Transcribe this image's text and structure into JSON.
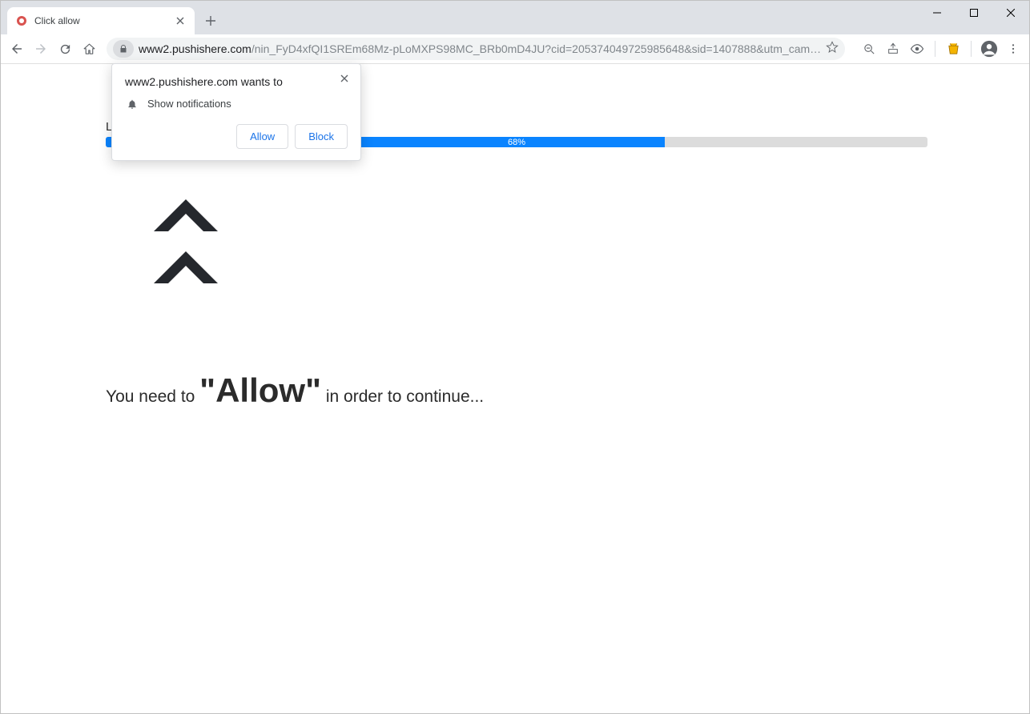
{
  "tab": {
    "title": "Click allow"
  },
  "url": {
    "host": "www2.pushishere.com",
    "path": "/nin_FyD4xfQI1SREm68Mz-pLoMXPS98MC_BRb0mD4JU?cid=205374049725985648&sid=1407888&utm_cam…"
  },
  "page": {
    "loading_label_partial": "L",
    "progress_percent_label": "68%",
    "message_before": "You need to ",
    "message_emphasis": "\"Allow\"",
    "message_after": " in order to continue..."
  },
  "permission": {
    "title": "www2.pushishere.com wants to",
    "row_label": "Show notifications",
    "allow_label": "Allow",
    "block_label": "Block"
  }
}
